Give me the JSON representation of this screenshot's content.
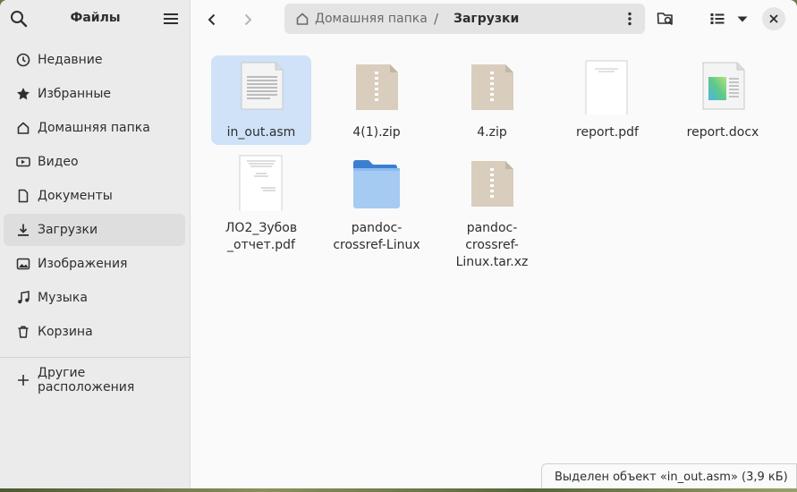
{
  "app": {
    "title": "Файлы"
  },
  "sidebar": {
    "items": [
      {
        "label": "Недавние",
        "icon": "clock-icon",
        "active": false
      },
      {
        "label": "Избранные",
        "icon": "star-icon",
        "active": false
      },
      {
        "label": "Домашняя папка",
        "icon": "home-icon",
        "active": false
      },
      {
        "label": "Видео",
        "icon": "video-icon",
        "active": false
      },
      {
        "label": "Документы",
        "icon": "document-icon",
        "active": true
      },
      {
        "label": "Загрузки",
        "icon": "download-icon",
        "active": true
      },
      {
        "label": "Изображения",
        "icon": "image-icon",
        "active": false
      },
      {
        "label": "Музыка",
        "icon": "music-icon",
        "active": false
      },
      {
        "label": "Корзина",
        "icon": "trash-icon",
        "active": false
      }
    ],
    "other_locations": "Другие расположения"
  },
  "path": {
    "home": "Домашняя папка",
    "separator": "/",
    "current": "Загрузки"
  },
  "files": [
    {
      "name": "in_out.asm",
      "type": "text",
      "selected": true
    },
    {
      "name": "4(1).zip",
      "type": "zip"
    },
    {
      "name": "4.zip",
      "type": "zip"
    },
    {
      "name": "report.pdf",
      "type": "pdf"
    },
    {
      "name": "report.docx",
      "type": "docx"
    },
    {
      "name": "ЛО2_Зубов\n_отчет.pdf",
      "type": "pdf"
    },
    {
      "name": "pandoc-\ncrossref-Linux",
      "type": "folder"
    },
    {
      "name": "pandoc-\ncrossref-\nLinux.tar.xz",
      "type": "zip"
    }
  ],
  "status": "Выделен объект «in_out.asm» (3,9 кБ)",
  "colors": {
    "selection": "#cfe2f7",
    "folder": "#4a90d9",
    "sidebar_bg": "#ebebeb"
  }
}
